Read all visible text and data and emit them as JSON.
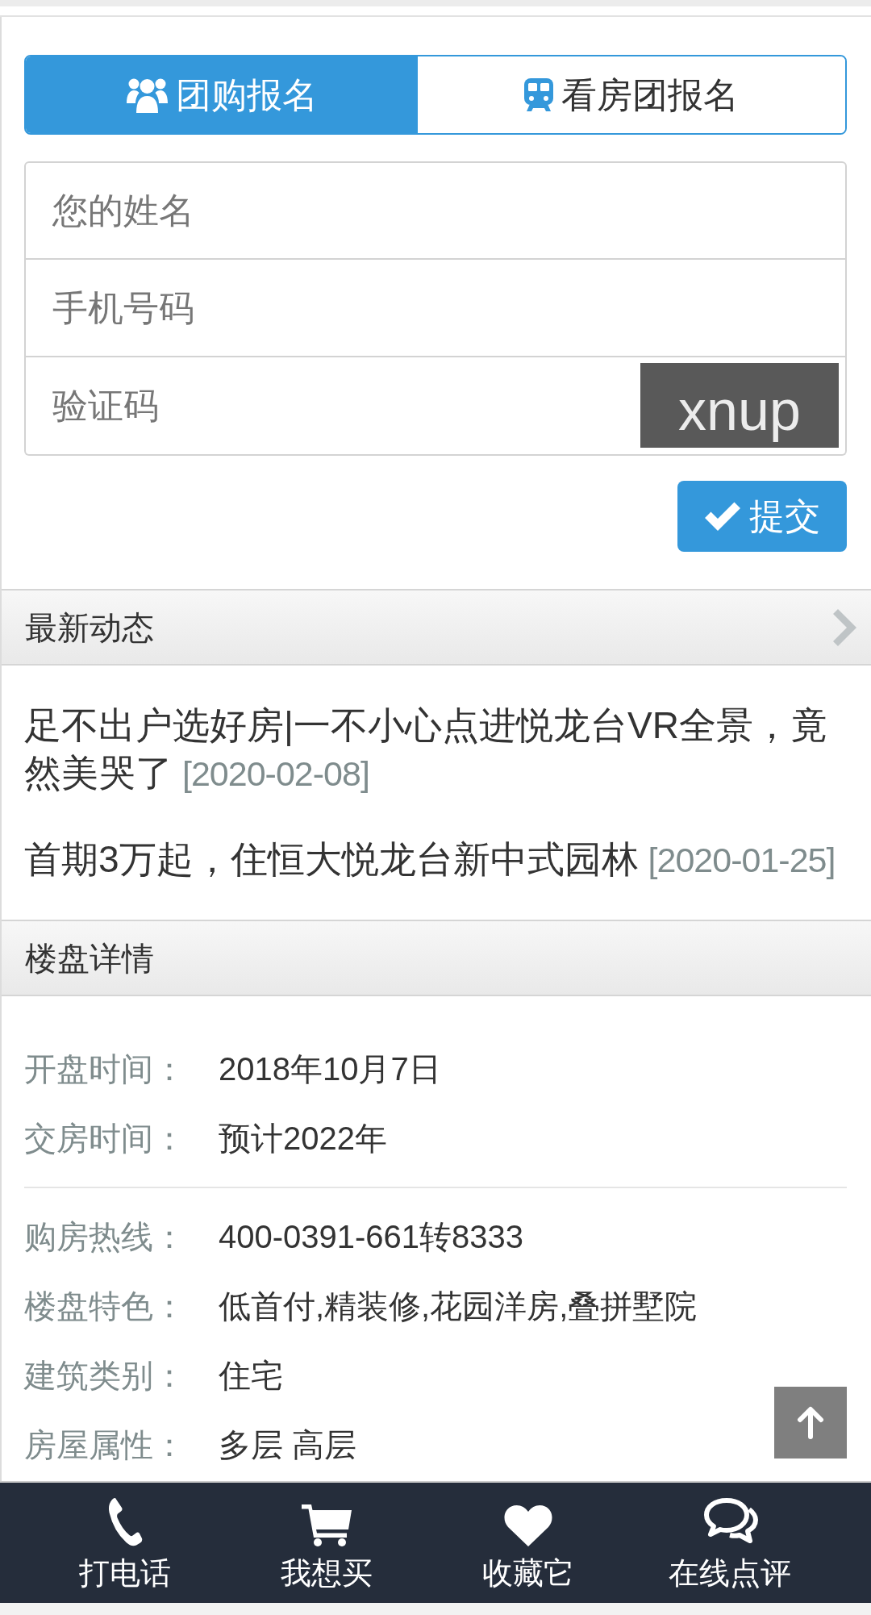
{
  "tabs": [
    {
      "label": "团购报名",
      "selected": true
    },
    {
      "label": "看房团报名",
      "selected": false
    }
  ],
  "form": {
    "fields": [
      {
        "placeholder": "您的姓名"
      },
      {
        "placeholder": "手机号码"
      },
      {
        "placeholder": "验证码",
        "captcha": "xnup"
      }
    ],
    "submit": "提交"
  },
  "news": {
    "title": "最新动态",
    "items": [
      {
        "text": "足不出户选好房|一不小心点进悦龙台VR全景，竟然美哭了",
        "date": "[2020-02-08]"
      },
      {
        "text": "首期3万起，住恒大悦龙台新中式园林",
        "date": "[2020-01-25]"
      }
    ]
  },
  "details": {
    "title": "楼盘详情",
    "groups": [
      {
        "rows": [
          {
            "label": "开盘时间：",
            "value": "2018年10月7日"
          },
          {
            "label": "交房时间：",
            "value": "预计2022年"
          }
        ]
      },
      {
        "rows": [
          {
            "label": "购房热线：",
            "value": "400-0391-661转8333"
          },
          {
            "label": "楼盘特色：",
            "value": "低首付,精装修,花园洋房,叠拼墅院"
          },
          {
            "label": "建筑类别：",
            "value": "住宅"
          },
          {
            "label": "房屋属性：",
            "value": "多层 高层"
          }
        ]
      }
    ]
  },
  "bottom_nav": [
    {
      "label": "打电话"
    },
    {
      "label": "我想买"
    },
    {
      "label": "收藏它"
    },
    {
      "label": "在线点评"
    }
  ]
}
